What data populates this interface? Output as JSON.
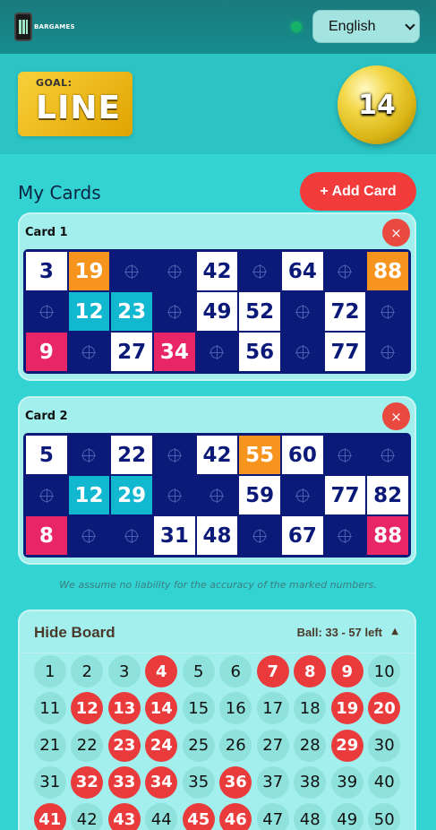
{
  "header": {
    "logo_text": "BARGAMES",
    "language": "English"
  },
  "goal": {
    "label": "GOAL:",
    "value": "LINE"
  },
  "current_ball": "14",
  "cards_section": {
    "title": "My Cards",
    "add_label": "+ Add Card"
  },
  "cards": [
    {
      "title": "Card 1",
      "close_label": "×",
      "rows": [
        [
          {
            "v": "3",
            "s": "num"
          },
          {
            "v": "19",
            "s": "orange"
          },
          {
            "v": "",
            "s": "empty"
          },
          {
            "v": "",
            "s": "empty"
          },
          {
            "v": "42",
            "s": "num"
          },
          {
            "v": "",
            "s": "empty"
          },
          {
            "v": "64",
            "s": "num"
          },
          {
            "v": "",
            "s": "empty"
          },
          {
            "v": "88",
            "s": "orange"
          }
        ],
        [
          {
            "v": "",
            "s": "empty"
          },
          {
            "v": "12",
            "s": "cyan"
          },
          {
            "v": "23",
            "s": "cyan"
          },
          {
            "v": "",
            "s": "empty"
          },
          {
            "v": "49",
            "s": "num"
          },
          {
            "v": "52",
            "s": "num"
          },
          {
            "v": "",
            "s": "empty"
          },
          {
            "v": "72",
            "s": "num"
          },
          {
            "v": "",
            "s": "empty"
          }
        ],
        [
          {
            "v": "9",
            "s": "pink"
          },
          {
            "v": "",
            "s": "empty"
          },
          {
            "v": "27",
            "s": "num"
          },
          {
            "v": "34",
            "s": "pink"
          },
          {
            "v": "",
            "s": "empty"
          },
          {
            "v": "56",
            "s": "num"
          },
          {
            "v": "",
            "s": "empty"
          },
          {
            "v": "77",
            "s": "num"
          },
          {
            "v": "",
            "s": "empty"
          }
        ]
      ]
    },
    {
      "title": "Card 2",
      "close_label": "×",
      "rows": [
        [
          {
            "v": "5",
            "s": "num"
          },
          {
            "v": "",
            "s": "empty"
          },
          {
            "v": "22",
            "s": "num"
          },
          {
            "v": "",
            "s": "empty"
          },
          {
            "v": "42",
            "s": "num"
          },
          {
            "v": "55",
            "s": "orange"
          },
          {
            "v": "60",
            "s": "num"
          },
          {
            "v": "",
            "s": "empty"
          },
          {
            "v": "",
            "s": "empty"
          }
        ],
        [
          {
            "v": "",
            "s": "empty"
          },
          {
            "v": "12",
            "s": "cyan"
          },
          {
            "v": "29",
            "s": "cyan"
          },
          {
            "v": "",
            "s": "empty"
          },
          {
            "v": "",
            "s": "empty"
          },
          {
            "v": "59",
            "s": "num"
          },
          {
            "v": "",
            "s": "empty"
          },
          {
            "v": "77",
            "s": "num"
          },
          {
            "v": "82",
            "s": "num"
          }
        ],
        [
          {
            "v": "8",
            "s": "pink"
          },
          {
            "v": "",
            "s": "empty"
          },
          {
            "v": "",
            "s": "empty"
          },
          {
            "v": "31",
            "s": "num"
          },
          {
            "v": "48",
            "s": "num"
          },
          {
            "v": "",
            "s": "empty"
          },
          {
            "v": "67",
            "s": "num"
          },
          {
            "v": "",
            "s": "empty"
          },
          {
            "v": "88",
            "s": "pink"
          }
        ]
      ]
    }
  ],
  "disclaimer": "We assume no liability for the accuracy of the marked numbers.",
  "board": {
    "toggle_label": "Hide Board",
    "status": "Ball: 33 - 57 left",
    "toggle_icon": "▲",
    "numbers": [
      "1",
      "2",
      "3",
      "4",
      "5",
      "6",
      "7",
      "8",
      "9",
      "10",
      "11",
      "12",
      "13",
      "14",
      "15",
      "16",
      "17",
      "18",
      "19",
      "20",
      "21",
      "22",
      "23",
      "24",
      "25",
      "26",
      "27",
      "28",
      "29",
      "30",
      "31",
      "32",
      "33",
      "34",
      "35",
      "36",
      "37",
      "38",
      "39",
      "40",
      "41",
      "42",
      "43",
      "44",
      "45",
      "46",
      "47",
      "48",
      "49",
      "50"
    ],
    "drawn": [
      "4",
      "7",
      "8",
      "9",
      "12",
      "13",
      "14",
      "19",
      "20",
      "23",
      "24",
      "29",
      "32",
      "33",
      "34",
      "36",
      "41",
      "43",
      "45",
      "46"
    ]
  },
  "colors": {
    "background": "#34d3d3",
    "drawn_ball": "#e93b3b",
    "card_grid": "#0b1a78",
    "marked_orange": "#f7941d",
    "marked_cyan": "#12b7d0",
    "marked_pink": "#e82566"
  }
}
